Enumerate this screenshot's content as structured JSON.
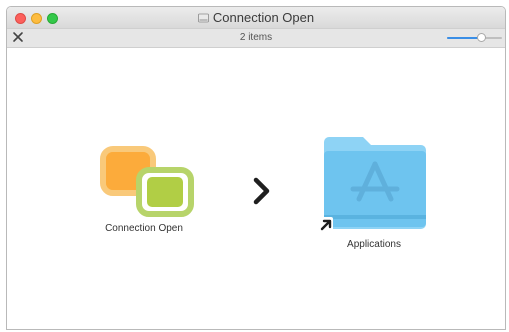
{
  "window": {
    "title": "Connection Open",
    "item_count": "2 items",
    "zoom_level": 0.62
  },
  "icons": {
    "title": "disk-image-icon",
    "toolbar": "close-icon",
    "arrow": "chevron-right-icon"
  },
  "items": [
    {
      "label": "Connection Open",
      "icon": "connection-open-app-icon"
    },
    {
      "label": "Applications",
      "icon": "applications-folder-icon"
    }
  ],
  "colors": {
    "close": "#fc605c",
    "minimize": "#fdbc40",
    "zoom": "#34c84a",
    "slider_accent": "#3a8ee6",
    "folder": "#6ec4ef"
  }
}
